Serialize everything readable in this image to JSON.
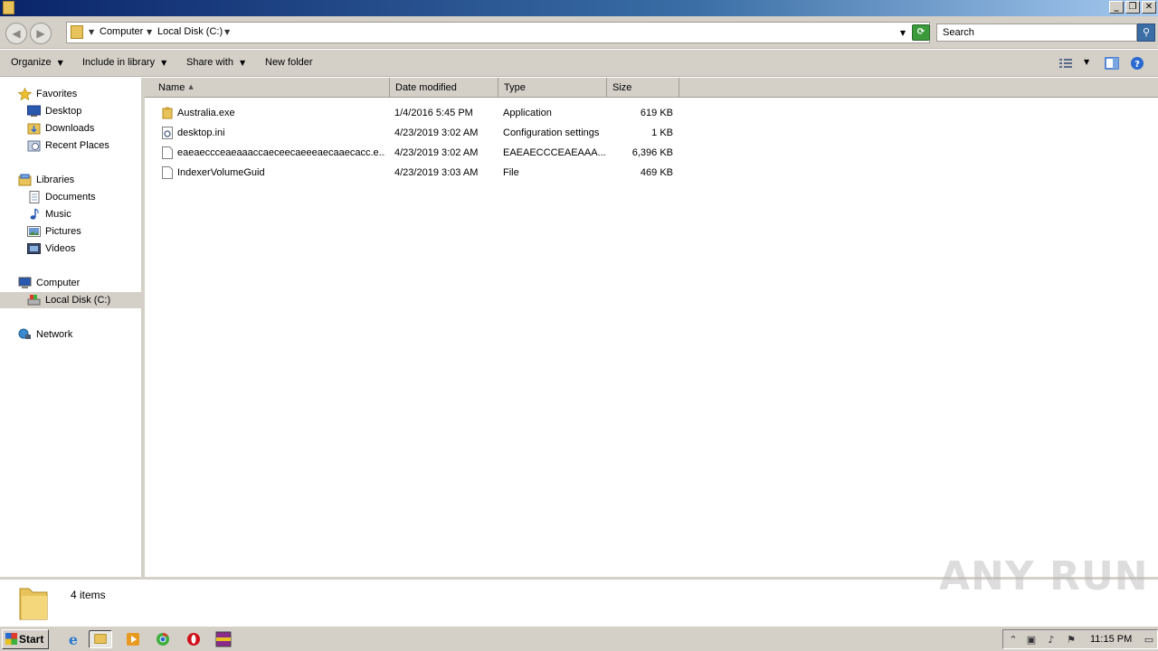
{
  "window": {
    "controls": [
      "_",
      "❐",
      "✕"
    ]
  },
  "address": {
    "crumbs": [
      "Computer",
      "Local Disk (C:)"
    ],
    "search_placeholder": "Search"
  },
  "toolbar": {
    "organize": "Organize",
    "include_in_library": "Include in library",
    "share_with": "Share with",
    "new_folder": "New folder"
  },
  "nav": {
    "favorites": "Favorites",
    "desktop": "Desktop",
    "downloads": "Downloads",
    "recent_places": "Recent Places",
    "libraries": "Libraries",
    "documents": "Documents",
    "music": "Music",
    "pictures": "Pictures",
    "videos": "Videos",
    "computer": "Computer",
    "local_disk": "Local Disk (C:)",
    "network": "Network"
  },
  "columns": [
    "Name",
    "Date modified",
    "Type",
    "Size"
  ],
  "files": [
    {
      "name": "Australia.exe",
      "date": "1/4/2016 5:45 PM",
      "type": "Application",
      "size": "619 KB",
      "icon": "exe-icon"
    },
    {
      "name": "desktop.ini",
      "date": "4/23/2019 3:02 AM",
      "type": "Configuration settings",
      "size": "1 KB",
      "icon": "settings-file-icon"
    },
    {
      "name": "eaeaeccceaeaaaccaeceecaeeeaecaaecacc.e...",
      "date": "4/23/2019 3:02 AM",
      "type": "EAEAECCCEAEAAA...",
      "size": "6,396 KB",
      "icon": "blank-file-icon"
    },
    {
      "name": "IndexerVolumeGuid",
      "date": "4/23/2019 3:03 AM",
      "type": "File",
      "size": "469 KB",
      "icon": "blank-file-icon"
    }
  ],
  "status": {
    "item_count": "4 items"
  },
  "watermark": "ANY RUN",
  "taskbar": {
    "start": "Start",
    "clock": "11:15 PM"
  },
  "colors": {
    "title_gradient_start": "#0a246a",
    "chrome": "#d4d0c8",
    "folder_yellow": "#e8c25a"
  }
}
